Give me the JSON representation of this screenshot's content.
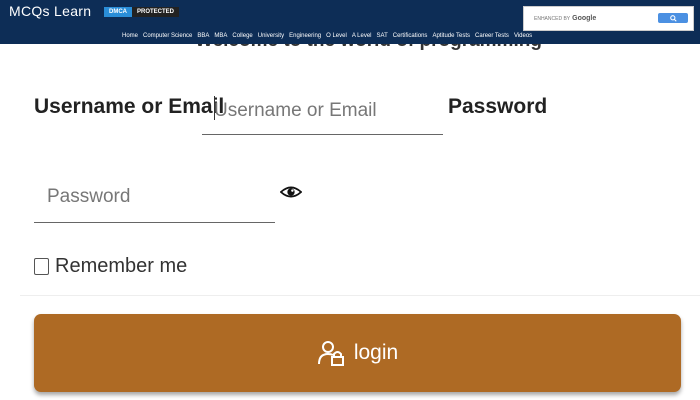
{
  "header": {
    "logo": "MCQs Learn",
    "badge_dmca": "DMCA",
    "badge_protected": "PROTECTED",
    "search": {
      "enhanced_text": "ENHANCED BY",
      "google_text": "Google"
    },
    "nav": [
      "Home",
      "Computer Science",
      "BBA",
      "MBA",
      "College",
      "University",
      "Engineering",
      "O Level",
      "A Level",
      "SAT",
      "Certifications",
      "Aptitude Tests",
      "Career Tests",
      "Videos"
    ]
  },
  "main": {
    "welcome": "Welcome to the world of programming",
    "username_label": "Username or Email",
    "username_placeholder": "Username or Email",
    "password_label": "Password",
    "password_placeholder": "Password",
    "remember_label": "Remember me",
    "login_label": "login"
  },
  "colors": {
    "header_bg": "#0d2d56",
    "login_bg": "#ae6a24",
    "dmca_blue": "#2a8ed8"
  },
  "icons": {
    "eye": "eye-icon",
    "login": "user-lock-icon",
    "search": "search-icon"
  }
}
